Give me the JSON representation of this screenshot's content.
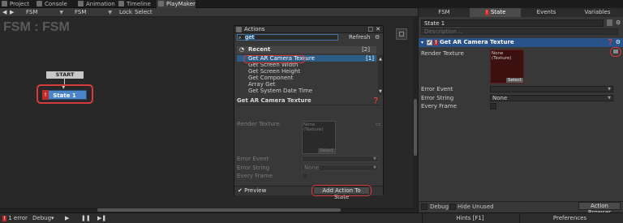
{
  "tabs": [
    {
      "label": "Project",
      "icon": "folder-icon"
    },
    {
      "label": "Console",
      "icon": "console-icon"
    },
    {
      "label": "Animation",
      "icon": "animation-icon"
    },
    {
      "label": "Timeline",
      "icon": "timeline-icon"
    },
    {
      "label": "PlayMaker",
      "icon": "playmaker-icon",
      "active": true
    }
  ],
  "toolbar": {
    "nav_back": "◀",
    "nav_forward": "▶",
    "dropdown1": "FSM",
    "dropdown2": "FSM",
    "lock": "Lock",
    "select": "Select"
  },
  "canvas": {
    "title": "FSM : FSM",
    "start_label": "START",
    "state_label": "State 1",
    "error_mark": "!"
  },
  "actions_window": {
    "title": "Actions",
    "search_value": "get",
    "refresh_label": "Refresh",
    "category": {
      "label": "Recent",
      "count": "[2]"
    },
    "items": [
      {
        "label": "Get AR Camera Texture",
        "count": "[1]"
      },
      {
        "label": "Get Screen Width"
      },
      {
        "label": "Get Screen Height"
      },
      {
        "label": "Get Component"
      },
      {
        "label": "Array Get"
      },
      {
        "label": "Get System Date Time"
      }
    ],
    "detail_title": "Get AR Camera Texture",
    "fields": {
      "render_texture": "Render Texture",
      "texture_value": "None (Texture)",
      "select": "Select",
      "error_event": "Error Event",
      "error_string": "Error String",
      "error_string_value": "None",
      "every_frame": "Every Frame"
    },
    "preview_label": "Preview",
    "add_button": "Add Action To State",
    "colors": {
      "highlight": "#d63b3b",
      "selection": "#2c5d87"
    }
  },
  "right_panel": {
    "tabs": [
      "FSM",
      "State",
      "Events",
      "Variables"
    ],
    "state_name": "State 1",
    "description_placeholder": "Description...",
    "action_title": "Get AR Camera Texture",
    "fields": {
      "render_texture": "Render Texture",
      "texture_value": "None (Texture)",
      "select": "Select",
      "error_event": "Error Event",
      "error_string": "Error String",
      "error_string_value": "None",
      "every_frame": "Every Frame"
    },
    "debug_label": "Debug",
    "hide_unused_label": "Hide Unused",
    "action_browser": "Action Browser",
    "hints": "Hints [F1]",
    "preferences": "Preferences"
  },
  "bottom_bar": {
    "errors": "1 error",
    "debug": "Debug▾",
    "play": "▶",
    "pause": "❚❚",
    "step": "▶❚"
  }
}
